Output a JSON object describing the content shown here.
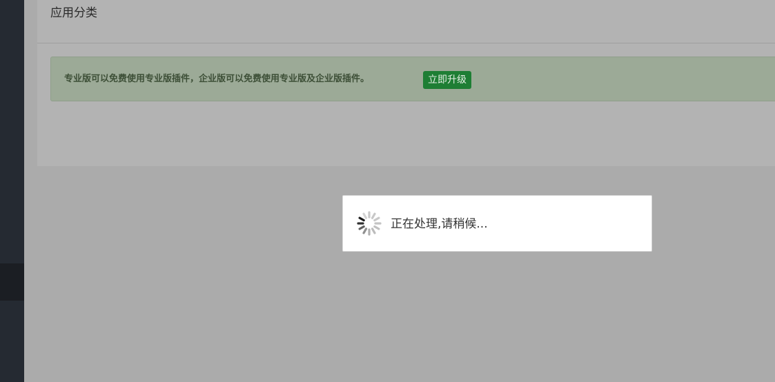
{
  "panel": {
    "title": "应用分类"
  },
  "alert": {
    "message": "专业版可以免费使用专业版插件，企业版可以免费使用专业版及企业版插件。",
    "upgrade_label": "立即升级"
  },
  "loading": {
    "message": "正在处理,请稍候...",
    "icon": "spinner-icon"
  },
  "colors": {
    "sidebar": "#252a32",
    "overlay": "#ababab",
    "alert_bg": "#9caa97",
    "upgrade_button": "#1e7e34"
  }
}
